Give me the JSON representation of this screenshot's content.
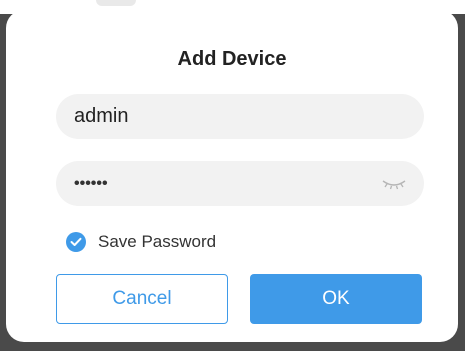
{
  "dialog": {
    "title": "Add Device",
    "username": {
      "value": "admin"
    },
    "password": {
      "masked_value": "••••••",
      "toggle_icon": "eye-closed-icon"
    },
    "save_password": {
      "label": "Save Password",
      "checked": true
    },
    "buttons": {
      "cancel_label": "Cancel",
      "ok_label": "OK"
    }
  },
  "colors": {
    "accent": "#3f9ae8",
    "field_bg": "#f2f2f2",
    "backdrop": "#4a4a4a"
  }
}
